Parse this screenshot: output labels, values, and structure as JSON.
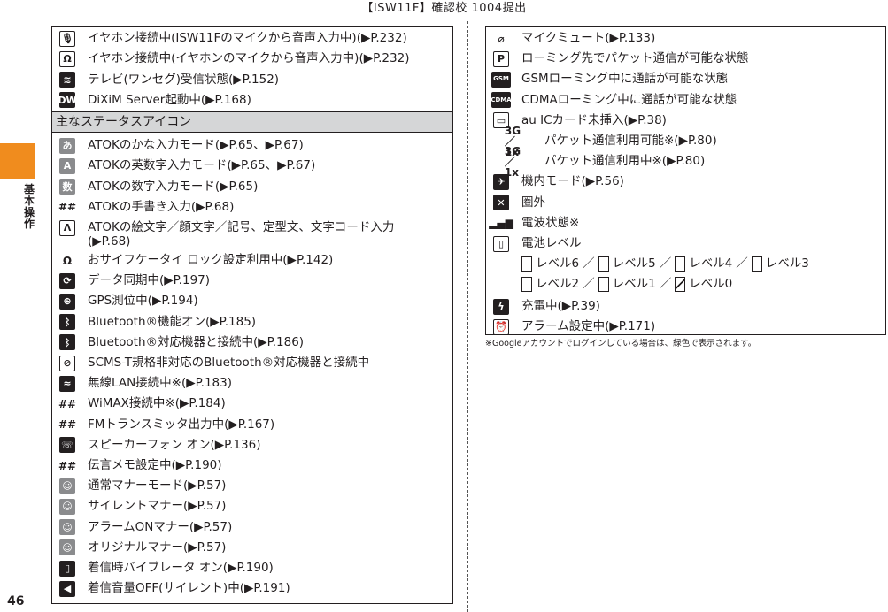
{
  "header": {
    "title": "【ISW11F】確認校 1004提出"
  },
  "side": {
    "chars": [
      "基",
      "本",
      "操",
      "作"
    ]
  },
  "page_number": "46",
  "left_rows_top": [
    {
      "icon": "mic-icon",
      "glyph": "🎙",
      "style": "outline",
      "text": "イヤホン接続中(ISW11Fのマイクから音声入力中)(▶P.232)"
    },
    {
      "icon": "earphone-mic-icon",
      "glyph": "Ω",
      "style": "outline",
      "text": "イヤホン接続中(イヤホンのマイクから音声入力中)(▶P.232)"
    },
    {
      "icon": "tv-wave-icon",
      "glyph": "≋",
      "style": "dark",
      "text": "テレビ(ワンセグ)受信状態(▶P.152)"
    },
    {
      "icon": "dixim-icon",
      "glyph": "DW",
      "style": "dark",
      "text": "DiXiM Server起動中(▶P.168)"
    }
  ],
  "section_heading": "主なステータスアイコン",
  "left_rows_bottom": [
    {
      "icon": "kana-input-icon",
      "glyph": "あ",
      "style": "grey",
      "text": "ATOKのかな入力モード(▶P.65、▶P.67)"
    },
    {
      "icon": "alpha-input-icon",
      "glyph": "A",
      "style": "grey",
      "text": "ATOKの英数字入力モード(▶P.65、▶P.67)"
    },
    {
      "icon": "number-input-icon",
      "glyph": "数",
      "style": "grey",
      "text": "ATOKの数字入力モード(▶P.65)"
    },
    {
      "icon": "handwriting-icon",
      "glyph": "##",
      "style": "plain",
      "text": "ATOKの手書き入力(▶P.68)"
    },
    {
      "icon": "emoji-input-icon",
      "glyph": "Λ",
      "style": "outline",
      "text": "ATOKの絵文字／顔文字／記号、定型文、文字コード入力(▶P.68)",
      "wrap": true
    },
    {
      "icon": "osaifu-lock-icon",
      "glyph": "Ω",
      "style": "plain",
      "text": "おサイフケータイ ロック設定利用中(▶P.142)"
    },
    {
      "icon": "sync-icon",
      "glyph": "⟳",
      "style": "dark",
      "text": "データ同期中(▶P.197)"
    },
    {
      "icon": "gps-icon",
      "glyph": "⊕",
      "style": "dark",
      "text": "GPS測位中(▶P.194)"
    },
    {
      "icon": "bluetooth-icon",
      "glyph": "ᛒ",
      "style": "dark",
      "text": "Bluetooth®機能オン(▶P.185)"
    },
    {
      "icon": "bluetooth-connected-icon",
      "glyph": "ᛒ",
      "style": "dark",
      "text": "Bluetooth®対応機器と接続中(▶P.186)"
    },
    {
      "icon": "scms-t-icon",
      "glyph": "⊘",
      "style": "outline",
      "text": "SCMS-T規格非対応のBluetooth®対応機器と接続中"
    },
    {
      "icon": "wifi-icon",
      "glyph": "≈",
      "style": "dark",
      "text": "無線LAN接続中※(▶P.183)"
    },
    {
      "icon": "wimax-icon",
      "glyph": "##",
      "style": "plain",
      "text": "WiMAX接続中※(▶P.184)"
    },
    {
      "icon": "fm-transmitter-icon",
      "glyph": "##",
      "style": "plain",
      "text": "FMトランスミッタ出力中(▶P.167)"
    },
    {
      "icon": "speakerphone-icon",
      "glyph": "☏",
      "style": "dark",
      "text": "スピーカーフォン オン(▶P.136)"
    },
    {
      "icon": "voice-memo-icon",
      "glyph": "##",
      "style": "plain",
      "text": "伝言メモ設定中(▶P.190)"
    },
    {
      "icon": "manner-normal-icon",
      "glyph": "☺",
      "style": "grey",
      "text": "通常マナーモード(▶P.57)"
    },
    {
      "icon": "manner-silent-icon",
      "glyph": "☺",
      "style": "grey",
      "text": "サイレントマナー(▶P.57)"
    },
    {
      "icon": "manner-alarm-icon",
      "glyph": "☺",
      "style": "grey",
      "text": "アラームONマナー(▶P.57)"
    },
    {
      "icon": "manner-original-icon",
      "glyph": "☺",
      "style": "grey",
      "text": "オリジナルマナー(▶P.57)"
    },
    {
      "icon": "vibrate-icon",
      "glyph": "▯",
      "style": "dark",
      "text": "着信時バイブレータ オン(▶P.190)"
    },
    {
      "icon": "ringer-off-icon",
      "glyph": "◀",
      "style": "dark",
      "text": "着信音量OFF(サイレント)中(▶P.191)"
    }
  ],
  "right_rows": [
    {
      "icon": "mic-mute-icon",
      "glyph": "⌀",
      "style": "plain",
      "text": "マイクミュート(▶P.133)"
    },
    {
      "icon": "roaming-packet-icon",
      "glyph": "P",
      "style": "outline",
      "text": "ローミング先でパケット通信が可能な状態"
    },
    {
      "icon": "gsm-roaming-icon",
      "glyph": "GSM",
      "style": "dark",
      "wide": true,
      "text": "GSMローミング中に通話が可能な状態"
    },
    {
      "icon": "cdma-roaming-icon",
      "glyph": "CDMA",
      "style": "dark",
      "wide": true,
      "text": "CDMAローミング中に通話が可能な状態"
    },
    {
      "icon": "no-ic-card-icon",
      "glyph": "▭",
      "style": "outline",
      "text": "au ICカード未挿入(▶P.38)"
    },
    {
      "icon": "packet-available-icon",
      "glyph": "3G／1x",
      "style": "plain",
      "text": "パケット通信利用可能※(▶P.80)",
      "pair": true
    },
    {
      "icon": "packet-active-icon",
      "glyph": "3G／1x",
      "style": "plain",
      "text": "パケット通信利用中※(▶P.80)",
      "pair": true
    },
    {
      "icon": "airplane-mode-icon",
      "glyph": "✈",
      "style": "dark",
      "text": "機内モード(▶P.56)"
    },
    {
      "icon": "out-of-service-icon",
      "glyph": "✕",
      "style": "dark",
      "text": "圏外"
    },
    {
      "icon": "signal-strength-icon",
      "glyph": "▂▄▆",
      "style": "plain",
      "text": "電波状態※"
    },
    {
      "icon": "battery-icon",
      "glyph": "▯",
      "style": "outline",
      "text": "電池レベル"
    }
  ],
  "battery_levels_line1": [
    "レベル6",
    "レベル5",
    "レベル4",
    "レベル3"
  ],
  "battery_levels_line2": [
    "レベル2",
    "レベル1",
    "レベル0"
  ],
  "battery_separator": "／",
  "right_rows_after": [
    {
      "icon": "charging-icon",
      "glyph": "ϟ",
      "style": "dark",
      "text": "充電中(▶P.39)"
    },
    {
      "icon": "alarm-icon",
      "glyph": "⏰",
      "style": "outline",
      "text": "アラーム設定中(▶P.171)"
    }
  ],
  "footnote": "※Googleアカウントでログインしている場合は、緑色で表示されます。"
}
